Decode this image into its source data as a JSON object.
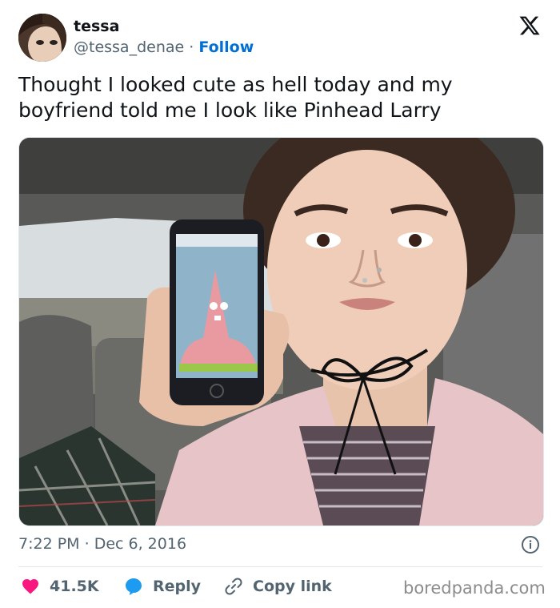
{
  "author": {
    "name": "tessa",
    "handle": "@tessa_denae",
    "separator": "·",
    "follow_label": "Follow"
  },
  "tweet": {
    "text_line1": "Thought I looked cute as hell today and my",
    "text_line2": "boyfriend told me I look like Pinhead Larry"
  },
  "meta": {
    "time": "7:22 PM",
    "separator": "·",
    "date": "Dec 6, 2016"
  },
  "actions": {
    "likes": "41.5K",
    "reply_label": "Reply",
    "copy_label": "Copy link"
  },
  "watermark": "boredpanda.com",
  "icons": {
    "logo": "x-logo-icon",
    "info": "info-icon",
    "like": "heart-icon",
    "reply": "speech-bubble-icon",
    "copy": "link-icon"
  },
  "colors": {
    "like": "#f91880",
    "reply": "#1d9bf0",
    "follow": "#006fd6",
    "text": "#0f1419",
    "muted": "#536471"
  }
}
